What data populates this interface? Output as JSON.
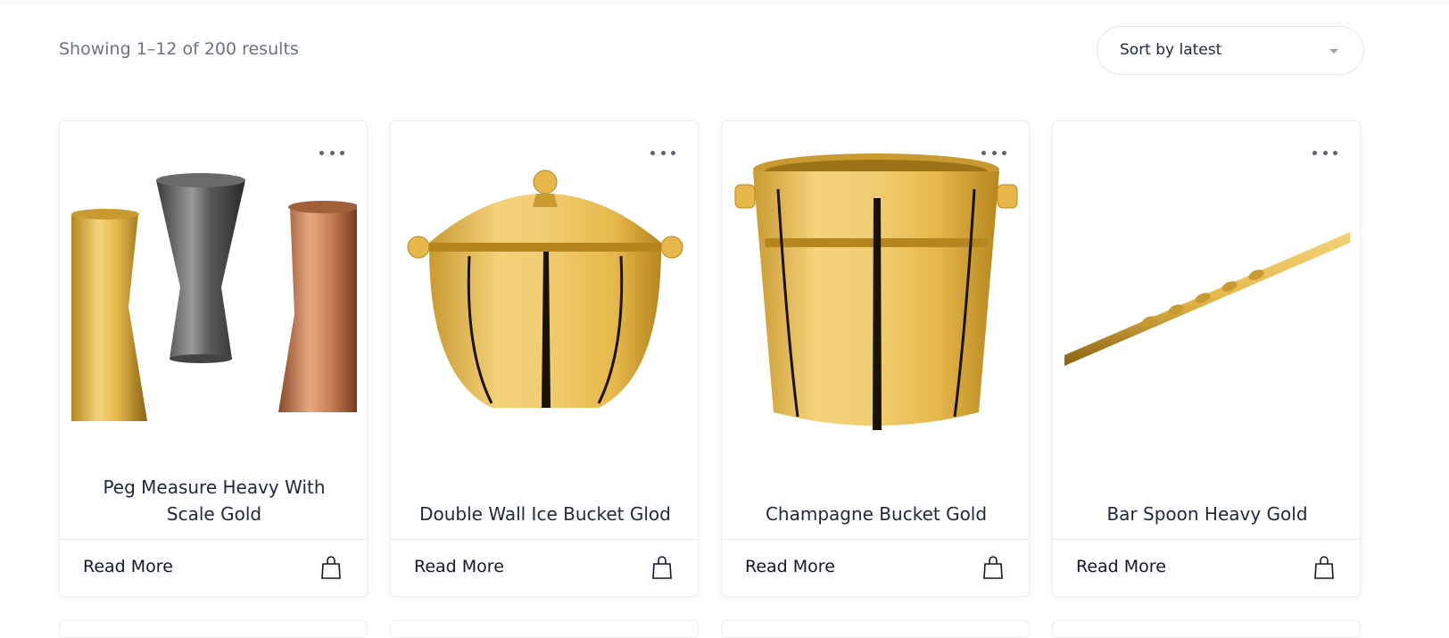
{
  "toolbar": {
    "result_count": "Showing 1–12 of 200 results",
    "sort": {
      "selected": "Sort by latest"
    }
  },
  "products": [
    {
      "title": "Peg Measure Heavy With Scale Gold",
      "read_more": "Read More",
      "image_icon": "jigger-set-image"
    },
    {
      "title": "Double Wall Ice Bucket Glod",
      "read_more": "Read More",
      "image_icon": "ice-bucket-image"
    },
    {
      "title": "Champagne Bucket Gold",
      "read_more": "Read More",
      "image_icon": "champagne-bucket-image"
    },
    {
      "title": "Bar Spoon Heavy Gold",
      "read_more": "Read More",
      "image_icon": "bar-spoon-image"
    }
  ],
  "colors": {
    "gold_light": "#f4d27a",
    "gold_mid": "#e6b84a",
    "gold_dark": "#b5861d",
    "text_dark": "#1f2937",
    "text_muted": "#6b7280",
    "border": "#eceef1"
  }
}
